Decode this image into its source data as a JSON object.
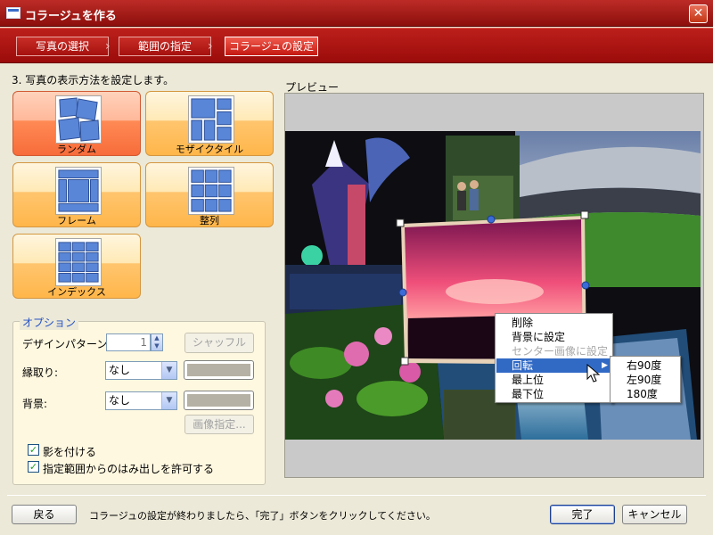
{
  "window": {
    "title": "コラージュを作る",
    "close_glyph": "✕"
  },
  "steps": [
    {
      "label": "写真の選択",
      "active": false
    },
    {
      "label": "範囲の指定",
      "active": false
    },
    {
      "label": "コラージュの設定",
      "active": true
    }
  ],
  "instruction": "3. 写真の表示方法を設定します。",
  "layouts": [
    {
      "label": "ランダム",
      "selected": true
    },
    {
      "label": "モザイクタイル",
      "selected": false
    },
    {
      "label": "フレーム",
      "selected": false
    },
    {
      "label": "整列",
      "selected": false
    },
    {
      "label": "インデックス",
      "selected": false
    }
  ],
  "options": {
    "legend": "オプション",
    "design_pattern_label": "デザインパターン:",
    "design_pattern_value": "1",
    "shuffle_button": "シャッフル",
    "border_label": "縁取り:",
    "border_value": "なし",
    "background_label": "背景:",
    "background_value": "なし",
    "image_button": "画像指定...",
    "shadow_checkbox": "影を付ける",
    "shadow_checked": true,
    "overflow_checkbox": "指定範囲からのはみ出しを許可する",
    "overflow_checked": true,
    "swatch_color": "#b5b1a4"
  },
  "preview": {
    "label": "プレビュー"
  },
  "context_menu": {
    "items": [
      {
        "label": "削除",
        "state": "normal"
      },
      {
        "label": "背景に設定",
        "state": "normal"
      },
      {
        "label": "センター画像に設定",
        "state": "disabled"
      },
      {
        "label": "回転",
        "state": "highlighted",
        "has_submenu": true
      },
      {
        "label": "最上位",
        "state": "normal"
      },
      {
        "label": "最下位",
        "state": "normal"
      }
    ],
    "submenu": [
      "右90度",
      "左90度",
      "180度"
    ]
  },
  "footer": {
    "back_button": "戻る",
    "status": "コラージュの設定が終わりましたら、「完了」ボタンをクリックしてください。",
    "finish_button": "完了",
    "cancel_button": "キャンセル"
  },
  "colors": {
    "title_bar": "#a0140f",
    "selected_layout": "#ff8a55",
    "layout_button": "#ffc56e",
    "menu_highlight": "#316ac5"
  }
}
